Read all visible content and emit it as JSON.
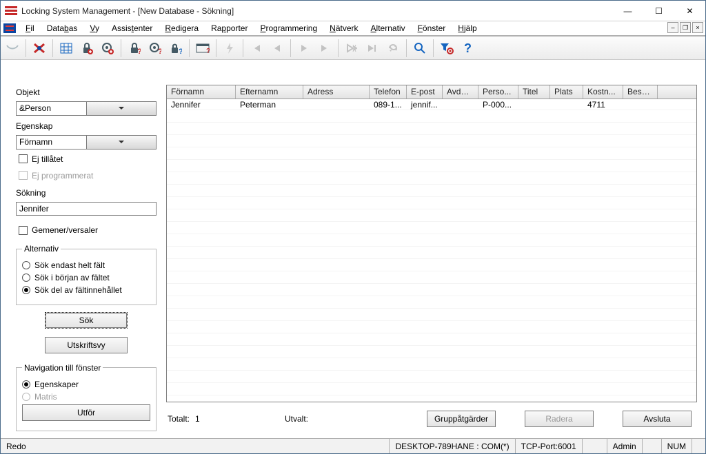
{
  "window": {
    "title": "Locking System Management - [New Database - Sökning]"
  },
  "menu": [
    {
      "label": "Fil",
      "u": 0
    },
    {
      "label": "Databas",
      "u": 4
    },
    {
      "label": "Vy",
      "u": 0
    },
    {
      "label": "Assistenter",
      "u": 5
    },
    {
      "label": "Redigera",
      "u": 0
    },
    {
      "label": "Rapporter",
      "u": 2
    },
    {
      "label": "Programmering",
      "u": 0
    },
    {
      "label": "Nätverk",
      "u": 0
    },
    {
      "label": "Alternativ",
      "u": 0
    },
    {
      "label": "Fönster",
      "u": 0
    },
    {
      "label": "Hjälp",
      "u": 0
    }
  ],
  "leftpanel": {
    "objekt_label": "Objekt",
    "objekt_value": "&Person",
    "egenskap_label": "Egenskap",
    "egenskap_value": "Förnamn",
    "chk_ejtillatet": "Ej tillåtet",
    "chk_ejprog": "Ej programmerat",
    "sokning_label": "Sökning",
    "sokning_value": "Jennifer",
    "chk_case": "Gemener/versaler",
    "alt_legend": "Alternativ",
    "r_helt": "Sök endast helt fält",
    "r_borjan": "Sök i början av fältet",
    "r_del": "Sök del av fältinnehållet",
    "btn_sok": "Sök",
    "btn_utskrift": "Utskriftsvy",
    "nav_legend": "Navigation till fönster",
    "r_egenskaper": "Egenskaper",
    "r_matris": "Matris",
    "btn_utfor": "Utför"
  },
  "grid": {
    "columns": [
      "Förnamn",
      "Efternamn",
      "Adress",
      "Telefon",
      "E-post",
      "Avdel...",
      "Perso...",
      "Titel",
      "Plats",
      "Kostn...",
      "Beskri..."
    ],
    "rows": [
      {
        "c0": "Jennifer",
        "c1": "Peterman",
        "c2": "",
        "c3": "089-1...",
        "c4": "jennif...",
        "c5": "",
        "c6": "P-000...",
        "c7": "",
        "c8": "",
        "c9": "4711",
        "c10": ""
      }
    ]
  },
  "footer": {
    "totalt_label": "Totalt:",
    "totalt_value": "1",
    "utvalt_label": "Utvalt:",
    "btn_grupp": "Gruppåtgärder",
    "btn_radera": "Radera",
    "btn_avsluta": "Avsluta"
  },
  "status": {
    "ready": "Redo",
    "host": "DESKTOP-789HANE : COM(*)",
    "port": "TCP-Port:6001",
    "user": "Admin",
    "num": "NUM"
  }
}
